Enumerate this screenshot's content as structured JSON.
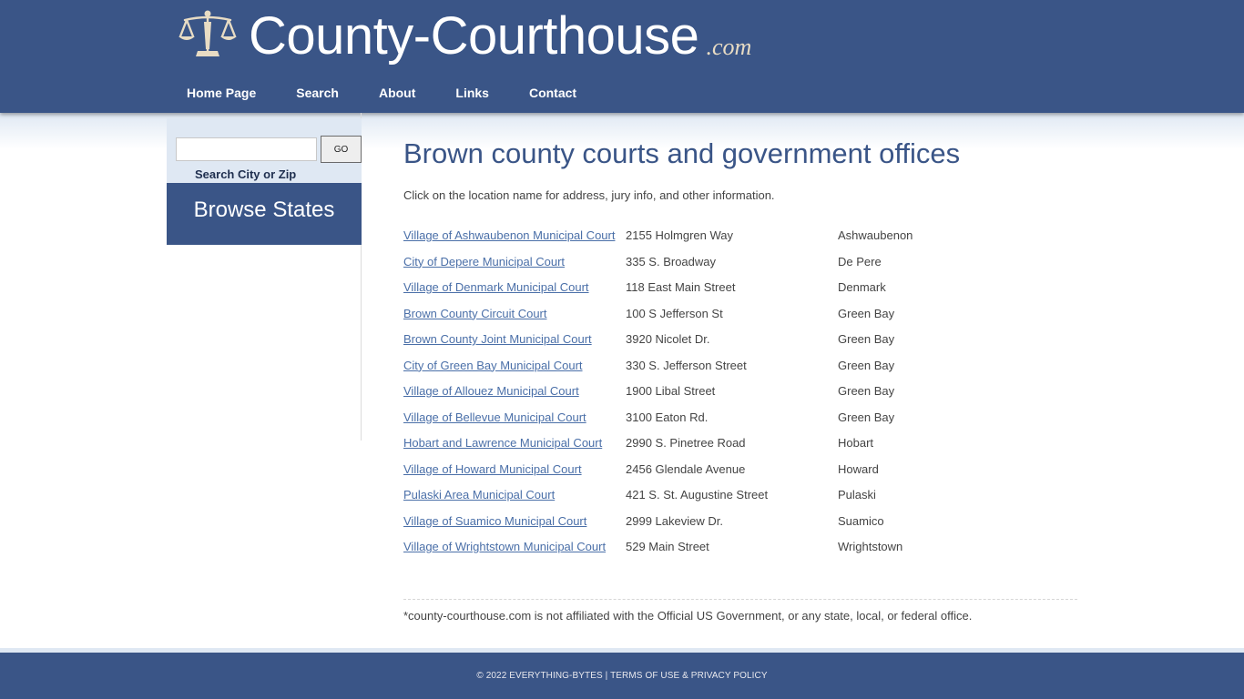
{
  "header": {
    "logo_text": "County-Courthouse",
    "logo_tld": ".com",
    "logo_icon": "scales-of-justice-icon",
    "nav": [
      {
        "label": "Home Page"
      },
      {
        "label": "Search"
      },
      {
        "label": "About"
      },
      {
        "label": "Links"
      },
      {
        "label": "Contact"
      }
    ]
  },
  "sidebar": {
    "search": {
      "value": "",
      "placeholder": "",
      "go_label": "GO",
      "label": "Search City or Zip"
    },
    "browse_states_label": "Browse States"
  },
  "main": {
    "title": "Brown county courts and government offices",
    "intro": "Click on the location name for address, jury info, and other information.",
    "courts": [
      {
        "name": "Village of Ashwaubenon Municipal Court",
        "address": "2155 Holmgren Way",
        "city": "Ashwaubenon"
      },
      {
        "name": "City of Depere Municipal Court",
        "address": "335 S. Broadway",
        "city": "De Pere"
      },
      {
        "name": "Village of Denmark Municipal Court",
        "address": "118 East Main Street",
        "city": "Denmark"
      },
      {
        "name": "Brown County Circuit Court",
        "address": "100 S Jefferson St",
        "city": "Green Bay"
      },
      {
        "name": "Brown County Joint Municipal Court",
        "address": "3920 Nicolet Dr.",
        "city": "Green Bay"
      },
      {
        "name": "City of Green Bay Municipal Court",
        "address": "330 S. Jefferson Street",
        "city": "Green Bay"
      },
      {
        "name": "Village of Allouez Municipal Court",
        "address": "1900 Libal Street",
        "city": "Green Bay"
      },
      {
        "name": "Village of Bellevue Municipal Court",
        "address": "3100 Eaton Rd.",
        "city": "Green Bay"
      },
      {
        "name": "Hobart and Lawrence Municipal Court",
        "address": "2990 S. Pinetree Road",
        "city": "Hobart"
      },
      {
        "name": "Village of Howard Municipal Court",
        "address": "2456 Glendale Avenue",
        "city": "Howard"
      },
      {
        "name": "Pulaski Area Municipal Court",
        "address": "421 S. St. Augustine Street",
        "city": "Pulaski"
      },
      {
        "name": "Village of Suamico Municipal Court",
        "address": "2999 Lakeview Dr.",
        "city": "Suamico"
      },
      {
        "name": "Village of Wrightstown Municipal Court",
        "address": "529 Main Street",
        "city": "Wrightstown"
      }
    ],
    "disclaimer": "*county-courthouse.com is not affiliated with the Official US Government, or any state, local, or federal office."
  },
  "footer": {
    "copyright": "© 2022 EVERYTHING-BYTES",
    "separator": " | ",
    "terms_label": "TERMS OF USE & PRIVACY POLICY"
  },
  "colors": {
    "brand_blue": "#3a5587",
    "light_blue": "#dfe8f3",
    "link_blue": "#4a6fa8",
    "tld_cream": "#e8dcc4"
  }
}
